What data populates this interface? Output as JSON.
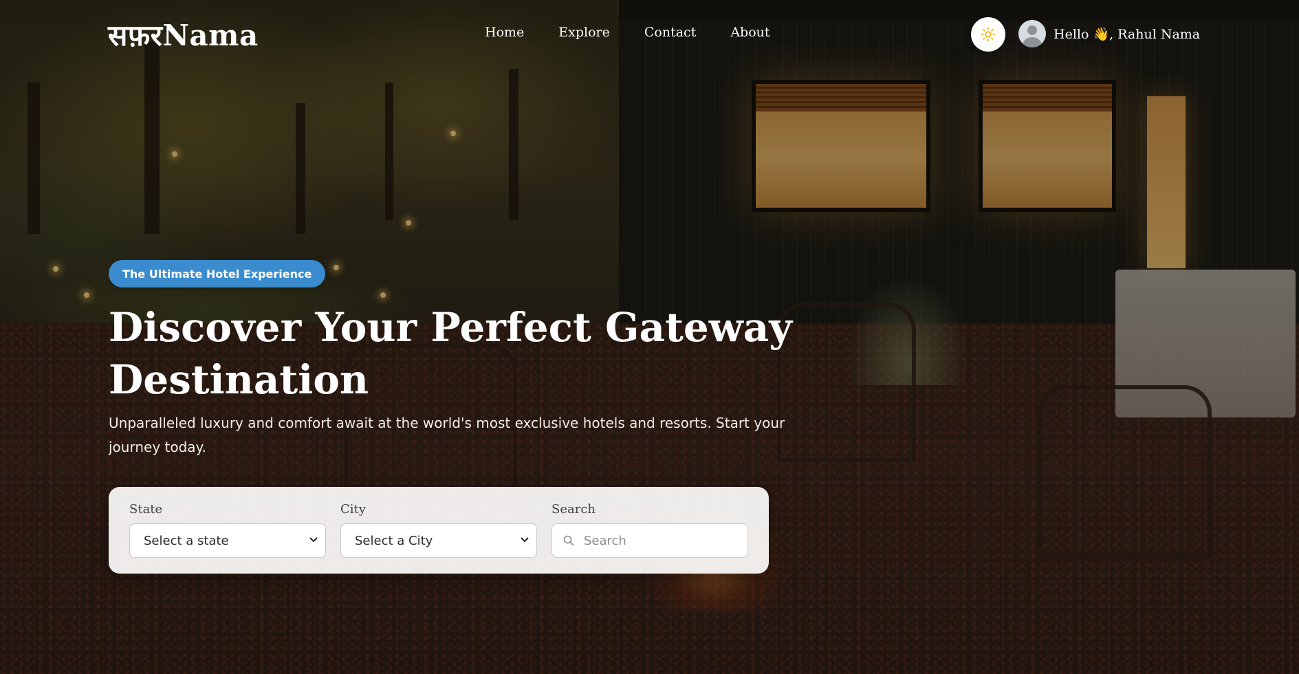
{
  "brand": {
    "logo_text": "सफ़रNama"
  },
  "nav": {
    "items": [
      "Home",
      "Explore",
      "Contact",
      "About"
    ]
  },
  "header": {
    "theme_icon": "sun-icon",
    "greeting": "Hello 👋, Rahul Nama"
  },
  "hero": {
    "badge": "The Ultimate Hotel Experience",
    "title_line1": "Discover Your Perfect Gateway",
    "title_line2": "Destination",
    "subtitle": "Unparalleled luxury and comfort await at the world's most exclusive hotels and resorts. Start your journey today."
  },
  "search_card": {
    "state": {
      "label": "State",
      "value": "Select a state"
    },
    "city": {
      "label": "City",
      "value": "Select a City"
    },
    "search": {
      "label": "Search",
      "placeholder": "Search"
    }
  },
  "colors": {
    "badge_bg": "#3a8ccf",
    "theme_icon": "#f2b51c",
    "card_bg": "#f6f4f2"
  }
}
